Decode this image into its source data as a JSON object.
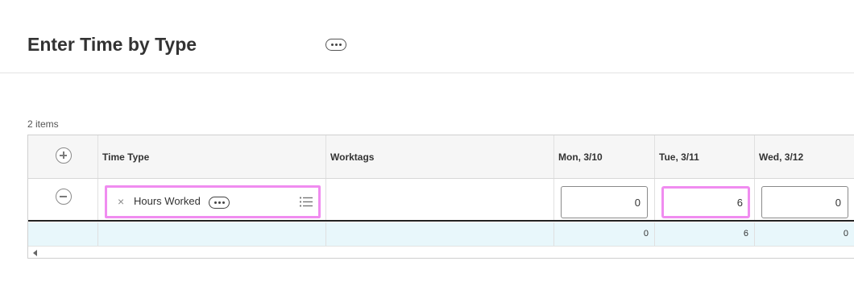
{
  "page": {
    "title": "Enter Time by Type"
  },
  "grid": {
    "items_count": "2 items",
    "columns": [
      "Time Type",
      "Worktags",
      "Mon, 3/10",
      "Tue, 3/11",
      "Wed, 3/12"
    ],
    "rows": [
      {
        "time_type": "Hours Worked",
        "worktags": "",
        "values": [
          "0",
          "6",
          "0"
        ]
      }
    ],
    "totals": [
      "0",
      "6",
      "0"
    ]
  },
  "colors": {
    "highlight": "#f08cf0",
    "total_row": "#e8f7fb",
    "header_row": "#f6f6f6"
  },
  "icons": {
    "add_row": "plus-circle-icon",
    "remove_row": "minus-circle-icon",
    "more": "ellipsis-icon",
    "clear": "close-icon",
    "prompt": "list-icon",
    "scroll": "scroll-left-icon"
  }
}
